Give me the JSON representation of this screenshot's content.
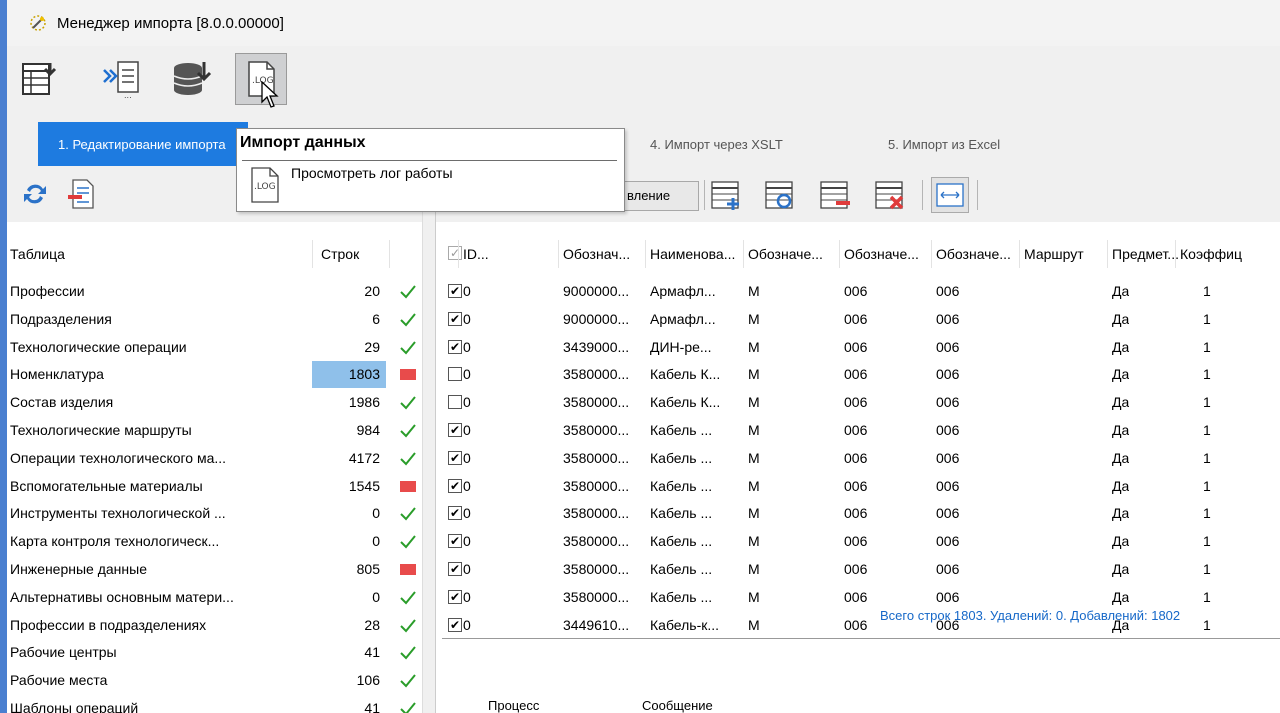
{
  "window": {
    "title": "Менеджер импорта [8.0.0.00000]",
    "icon": "wand-icon"
  },
  "toolbar": {
    "buttons": [
      {
        "icon": "import-table-icon"
      },
      {
        "icon": "xml-transform-icon"
      },
      {
        "icon": "database-import-icon"
      },
      {
        "icon": "log-file-icon",
        "label": ".LOG",
        "active": true
      }
    ]
  },
  "tabs": [
    {
      "label": "1. Редактирование импорта",
      "active": true
    },
    {
      "label": "4. Импорт через XSLT"
    },
    {
      "label": "5. Импорт из Excel"
    }
  ],
  "tooltip": {
    "title": "Импорт данных",
    "text": "Просмотреть лог работы",
    "icon_label": ".LOG"
  },
  "left": {
    "headers": {
      "table": "Таблица",
      "rows": "Строк"
    },
    "rows": [
      {
        "name": "Профессии",
        "count": "20",
        "status": "ok"
      },
      {
        "name": "Подразделения",
        "count": "6",
        "status": "ok"
      },
      {
        "name": "Технологические операции",
        "count": "29",
        "status": "ok"
      },
      {
        "name": "Номенклатура",
        "count": "1803",
        "status": "error",
        "selected": true
      },
      {
        "name": "Состав изделия",
        "count": "1986",
        "status": "ok"
      },
      {
        "name": "Технологические маршруты",
        "count": "984",
        "status": "ok"
      },
      {
        "name": "Операции технологического ма...",
        "count": "4172",
        "status": "ok"
      },
      {
        "name": "Вспомогательные материалы",
        "count": "1545",
        "status": "error"
      },
      {
        "name": "Инструменты технологической ...",
        "count": "0",
        "status": "ok"
      },
      {
        "name": "Карта контроля технологическ...",
        "count": "0",
        "status": "ok"
      },
      {
        "name": "Инженерные данные",
        "count": "805",
        "status": "error"
      },
      {
        "name": "Альтернативы основным матери...",
        "count": "0",
        "status": "ok"
      },
      {
        "name": "Профессии в подразделениях",
        "count": "28",
        "status": "ok"
      },
      {
        "name": "Рабочие центры",
        "count": "41",
        "status": "ok"
      },
      {
        "name": "Рабочие места",
        "count": "106",
        "status": "ok"
      },
      {
        "name": "Шаблоны операций",
        "count": "41",
        "status": "ok"
      }
    ]
  },
  "right": {
    "toolbar": {
      "partial_button": "вление"
    },
    "headers": [
      "ID...",
      "Обознач...",
      "Наименова...",
      "Обозначе...",
      "Обозначе...",
      "Обозначе...",
      "Маршрут",
      "Предмет...",
      "Коэффиц"
    ],
    "rows": [
      {
        "checked": true,
        "id": "0",
        "code": "9000000...",
        "name": "Армафл...",
        "c3": "М",
        "c4": "006",
        "c5": "006",
        "route": "",
        "subj": "Да",
        "coef": "1"
      },
      {
        "checked": true,
        "id": "0",
        "code": "9000000...",
        "name": "Армафл...",
        "c3": "М",
        "c4": "006",
        "c5": "006",
        "route": "",
        "subj": "Да",
        "coef": "1"
      },
      {
        "checked": true,
        "id": "0",
        "code": "3439000...",
        "name": "ДИН-ре...",
        "c3": "М",
        "c4": "006",
        "c5": "006",
        "route": "",
        "subj": "Да",
        "coef": "1"
      },
      {
        "checked": false,
        "id": "0",
        "code": "3580000...",
        "name": "Кабель К...",
        "c3": "М",
        "c4": "006",
        "c5": "006",
        "route": "",
        "subj": "Да",
        "coef": "1"
      },
      {
        "checked": false,
        "id": "0",
        "code": "3580000...",
        "name": "Кабель К...",
        "c3": "М",
        "c4": "006",
        "c5": "006",
        "route": "",
        "subj": "Да",
        "coef": "1"
      },
      {
        "checked": true,
        "id": "0",
        "code": "3580000...",
        "name": "Кабель ...",
        "c3": "М",
        "c4": "006",
        "c5": "006",
        "route": "",
        "subj": "Да",
        "coef": "1"
      },
      {
        "checked": true,
        "id": "0",
        "code": "3580000...",
        "name": "Кабель ...",
        "c3": "М",
        "c4": "006",
        "c5": "006",
        "route": "",
        "subj": "Да",
        "coef": "1"
      },
      {
        "checked": true,
        "id": "0",
        "code": "3580000...",
        "name": "Кабель ...",
        "c3": "М",
        "c4": "006",
        "c5": "006",
        "route": "",
        "subj": "Да",
        "coef": "1"
      },
      {
        "checked": true,
        "id": "0",
        "code": "3580000...",
        "name": "Кабель ...",
        "c3": "М",
        "c4": "006",
        "c5": "006",
        "route": "",
        "subj": "Да",
        "coef": "1"
      },
      {
        "checked": true,
        "id": "0",
        "code": "3580000...",
        "name": "Кабель ...",
        "c3": "М",
        "c4": "006",
        "c5": "006",
        "route": "",
        "subj": "Да",
        "coef": "1"
      },
      {
        "checked": true,
        "id": "0",
        "code": "3580000...",
        "name": "Кабель ...",
        "c3": "М",
        "c4": "006",
        "c5": "006",
        "route": "",
        "subj": "Да",
        "coef": "1"
      },
      {
        "checked": true,
        "id": "0",
        "code": "3580000...",
        "name": "Кабель ...",
        "c3": "М",
        "c4": "006",
        "c5": "006",
        "route": "",
        "subj": "Да",
        "coef": "1"
      },
      {
        "checked": true,
        "id": "0",
        "code": "3449610...",
        "name": "Кабель-к...",
        "c3": "М",
        "c4": "006",
        "c5": "006",
        "route": "",
        "subj": "Да",
        "coef": "1"
      }
    ],
    "summary": "Всего строк 1803. Удалений: 0. Добавлений: 1802",
    "bottom_headers": {
      "process": "Процесс",
      "message": "Сообщение"
    }
  },
  "colors": {
    "accent": "#1e7be0",
    "selected": "#8fc0ea",
    "error_flag": "#e84b4b",
    "ok_check": "#2a9d2a",
    "summary_text": "#1668c8"
  }
}
